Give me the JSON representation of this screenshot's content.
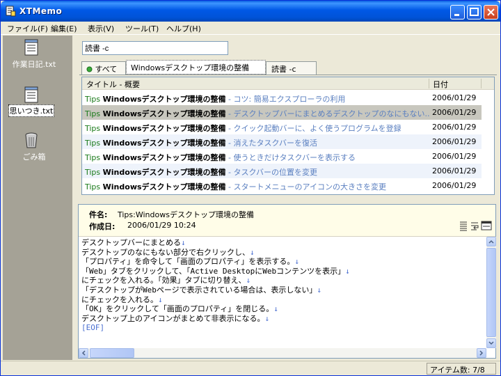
{
  "window": {
    "title": "XTMemo"
  },
  "menu": [
    "ファイル(F)",
    "編集(E)",
    "表示(V)",
    "ツール(T)",
    "ヘルプ(H)"
  ],
  "sidebar": {
    "items": [
      {
        "label": "作業日記.txt",
        "icon": "notepad-icon"
      },
      {
        "label": "思いつき.txt",
        "icon": "notepad-icon",
        "selected": true
      },
      {
        "label": "ごみ箱",
        "icon": "trash-icon"
      }
    ]
  },
  "search": {
    "value": "読書 -c"
  },
  "tabs": [
    {
      "label": "すべて",
      "active": false
    },
    {
      "label": "Windowsデスクトップ環境の整備",
      "active": true
    },
    {
      "label": "読書 -c",
      "active": false
    }
  ],
  "list": {
    "columns": [
      "タイトル - 概要",
      "日付"
    ],
    "rows": [
      {
        "tag": "Tips",
        "title": "Windowsデスクトップ環境の整備",
        "summary": " - コツ: 簡易エクスプローラの利用",
        "date": "2006/01/29"
      },
      {
        "tag": "Tips",
        "title": "Windowsデスクトップ環境の整備",
        "summary": " - デスクトップバーにまとめるデスクトップのなにもない...",
        "date": "2006/01/29",
        "selected": true
      },
      {
        "tag": "Tips",
        "title": "Windowsデスクトップ環境の整備",
        "summary": " - クイック起動バーに、よく使うプログラムを登録",
        "date": "2006/01/29"
      },
      {
        "tag": "Tips",
        "title": "Windowsデスクトップ環境の整備",
        "summary": " - 消えたタスクバーを復活",
        "date": "2006/01/29"
      },
      {
        "tag": "Tips",
        "title": "Windowsデスクトップ環境の整備",
        "summary": " - 使うときだけタスクバーを表示する",
        "date": "2006/01/29"
      },
      {
        "tag": "Tips",
        "title": "Windowsデスクトップ環境の整備",
        "summary": " - タスクバーの位置を変更",
        "date": "2006/01/29"
      },
      {
        "tag": "Tips",
        "title": "Windowsデスクトップ環境の整備",
        "summary": " - スタートメニューのアイコンの大きさを変更",
        "date": "2006/01/29"
      }
    ]
  },
  "detail": {
    "subject_label": "件名:",
    "subject": "Tips:Windowsデスクトップ環境の整備",
    "created_label": "作成日:",
    "created": "2006/01/29 10:24",
    "lines": [
      "デスクトップバーにまとめる",
      "デスクトップのなにもない部分で右クリックし、",
      "「プロパティ」を命令して「画面のプロパティ」を表示する。",
      "「Web」タブをクリックして、「Active DesktopにWebコンテンツを表示」",
      "にチェックを入れる。「効果」タブに切り替え、",
      "「デスクトップがWebページで表示されている場合は、表示しない」",
      "にチェックを入れる。",
      "「OK」をクリックして「画面のプロパティ」を閉じる。",
      "デスクトップ上のアイコンがまとめて非表示になる。"
    ],
    "eol": "↓",
    "eof": "[EOF]"
  },
  "status": {
    "text": "アイテム数: 7/8"
  }
}
